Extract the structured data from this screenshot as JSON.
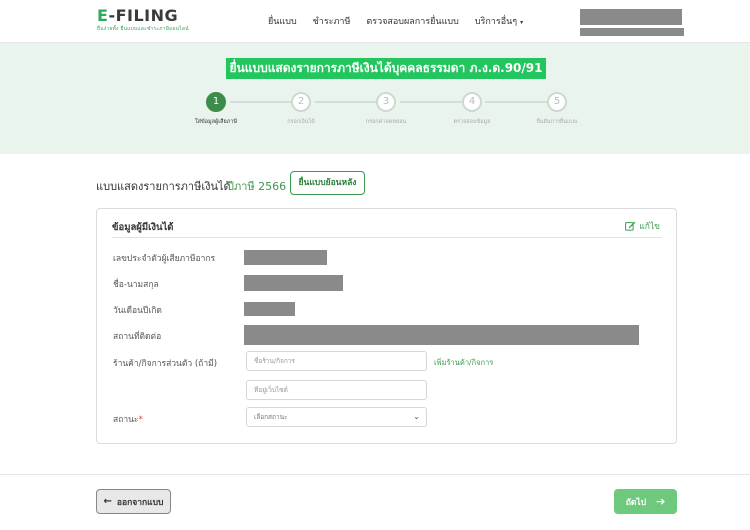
{
  "header": {
    "logo_prefix": "E",
    "logo_rest": "-FILING",
    "logo_tagline": "ยื่นง่ายทั้ง ยื่นแบบและชำระภาษีออนไลน์",
    "nav": [
      {
        "label": "ยื่นแบบ"
      },
      {
        "label": "ชำระภาษี"
      },
      {
        "label": "ตรวจสอบผลการยื่นแบบ"
      },
      {
        "label": "บริการอื่นๆ"
      }
    ],
    "nav_caret": "▾"
  },
  "banner": {
    "title": "ยื่นแบบแสดงรายการภาษีเงินได้บุคคลธรรมดา ภ.ง.ด.90/91",
    "steps": [
      {
        "number": "1",
        "label": "ใส่ข้อมูลผู้เสียภาษี",
        "active": true
      },
      {
        "number": "2",
        "label": "กรอกเงินได้",
        "active": false
      },
      {
        "number": "3",
        "label": "กรอกค่าลดหย่อน",
        "active": false
      },
      {
        "number": "4",
        "label": "ตรวจสอบข้อมูล",
        "active": false
      },
      {
        "number": "5",
        "label": "ยืนยันการยื่นแบบ",
        "active": false
      }
    ]
  },
  "section": {
    "title": "แบบแสดงรายการภาษีเงินได้",
    "year": "ปีภาษี 2566",
    "backfile_button": "ยื่นแบบย้อนหลัง"
  },
  "card": {
    "title": "ข้อมูลผู้มีเงินได้",
    "edit_label": "แก้ไข",
    "fields": {
      "tax_id_label": "เลขประจำตัวผู้เสียภาษีอากร",
      "name_label": "ชื่อ-นามสกุล",
      "birthdate_label": "วันเดือนปีเกิด",
      "address_label": "สถานที่ติดต่อ",
      "shop_label": "ร้านค้า/กิจการส่วนตัว (ถ้ามี)",
      "shop_name_placeholder": "ชื่อร้าน/กิจการ",
      "website_placeholder": "ที่อยู่เว็บไซต์",
      "add_shop_link": "เพิ่มร้านค้า/กิจการ",
      "status_label": "สถานะ",
      "status_required_mark": "*",
      "status_placeholder": "เลือกสถานะ"
    }
  },
  "footer": {
    "exit_button": "ออกจากแบบ",
    "next_button": "ถัดไป"
  },
  "colors": {
    "brand_green": "#2dab59",
    "step_active": "#3c8c4a",
    "banner_bg": "#e9f4ec",
    "title_bg": "#22c55e",
    "next_button": "#6fc97d",
    "mask_gray": "#8a8a8a"
  }
}
